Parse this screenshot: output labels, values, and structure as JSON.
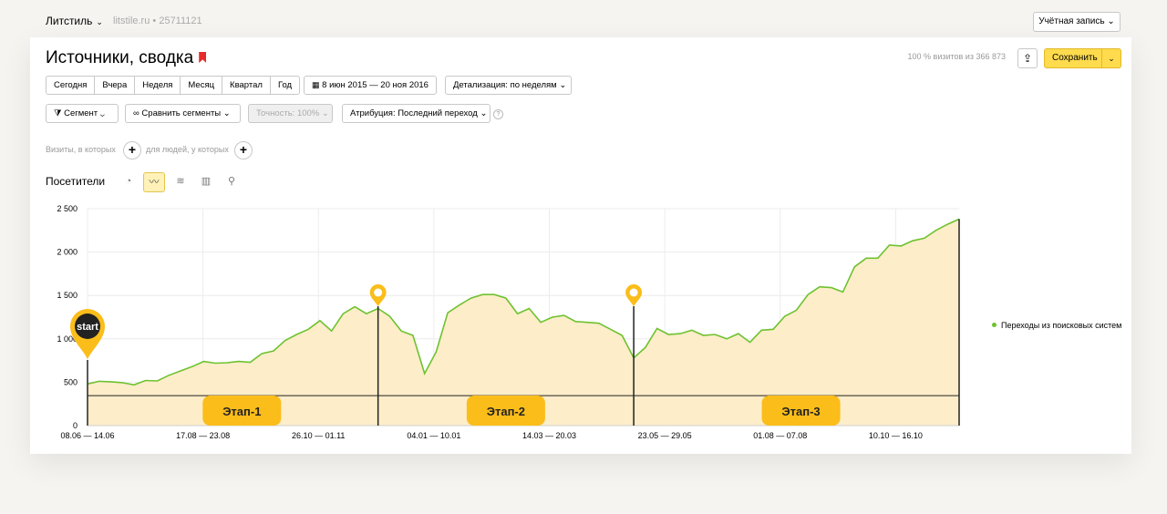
{
  "topbar": {
    "counter_name": "Литстиль",
    "site": "litstile.ru",
    "separator": "•",
    "counter_id": "25711121",
    "account": "Учётная запись"
  },
  "header": {
    "title": "Источники, сводка",
    "visits_share": "100 % визитов из 366 873",
    "save": "Сохранить"
  },
  "period_buttons": [
    "Сегодня",
    "Вчера",
    "Неделя",
    "Месяц",
    "Квартал",
    "Год"
  ],
  "date_range": "8 июн 2015 — 20 ноя 2016",
  "detail": "Детализация: по неделям",
  "toolbar2": {
    "segment": "Сегмент",
    "compare": "Сравнить сегменты",
    "accuracy": "Точность: 100%",
    "attribution": "Атрибуция: Последний переход",
    "help": "?"
  },
  "filters": {
    "visits_where": "Визиты, в которых",
    "people_where": "для людей, у которых"
  },
  "graph": {
    "title": "Посетители",
    "icons": [
      "pie-icon",
      "line-icon",
      "area-icon",
      "bar-icon",
      "map-icon"
    ]
  },
  "chart_data": {
    "type": "area",
    "ylim": [
      0,
      2500
    ],
    "yticks": [
      0,
      500,
      1000,
      1500,
      2000,
      2500
    ],
    "xticks": [
      "08.06 — 14.06",
      "17.08 — 23.08",
      "26.10 — 01.11",
      "04.01 — 10.01",
      "14.03 — 20.03",
      "23.05 — 29.05",
      "01.08 — 07.08",
      "10.10 — 16.10"
    ],
    "series": [
      {
        "name": "Переходы из поисковых систем",
        "color": "#6ec230",
        "values": [
          480,
          510,
          505,
          495,
          470,
          520,
          515,
          580,
          630,
          680,
          740,
          720,
          725,
          740,
          730,
          830,
          860,
          980,
          1050,
          1110,
          1210,
          1090,
          1290,
          1370,
          1290,
          1350,
          1260,
          1090,
          1040,
          600,
          850,
          1300,
          1390,
          1470,
          1510,
          1510,
          1470,
          1290,
          1350,
          1190,
          1250,
          1270,
          1200,
          1190,
          1180,
          1110,
          1040,
          780,
          900,
          1120,
          1050,
          1060,
          1100,
          1040,
          1050,
          1000,
          1060,
          960,
          1100,
          1110,
          1260,
          1330,
          1510,
          1600,
          1590,
          1540,
          1830,
          1930,
          1930,
          2080,
          2070,
          2130,
          2160,
          2250,
          2320,
          2380
        ]
      }
    ],
    "annotations": {
      "start_label": "start",
      "stages": [
        "Этап-1",
        "Этап-2",
        "Этап-3"
      ]
    }
  }
}
